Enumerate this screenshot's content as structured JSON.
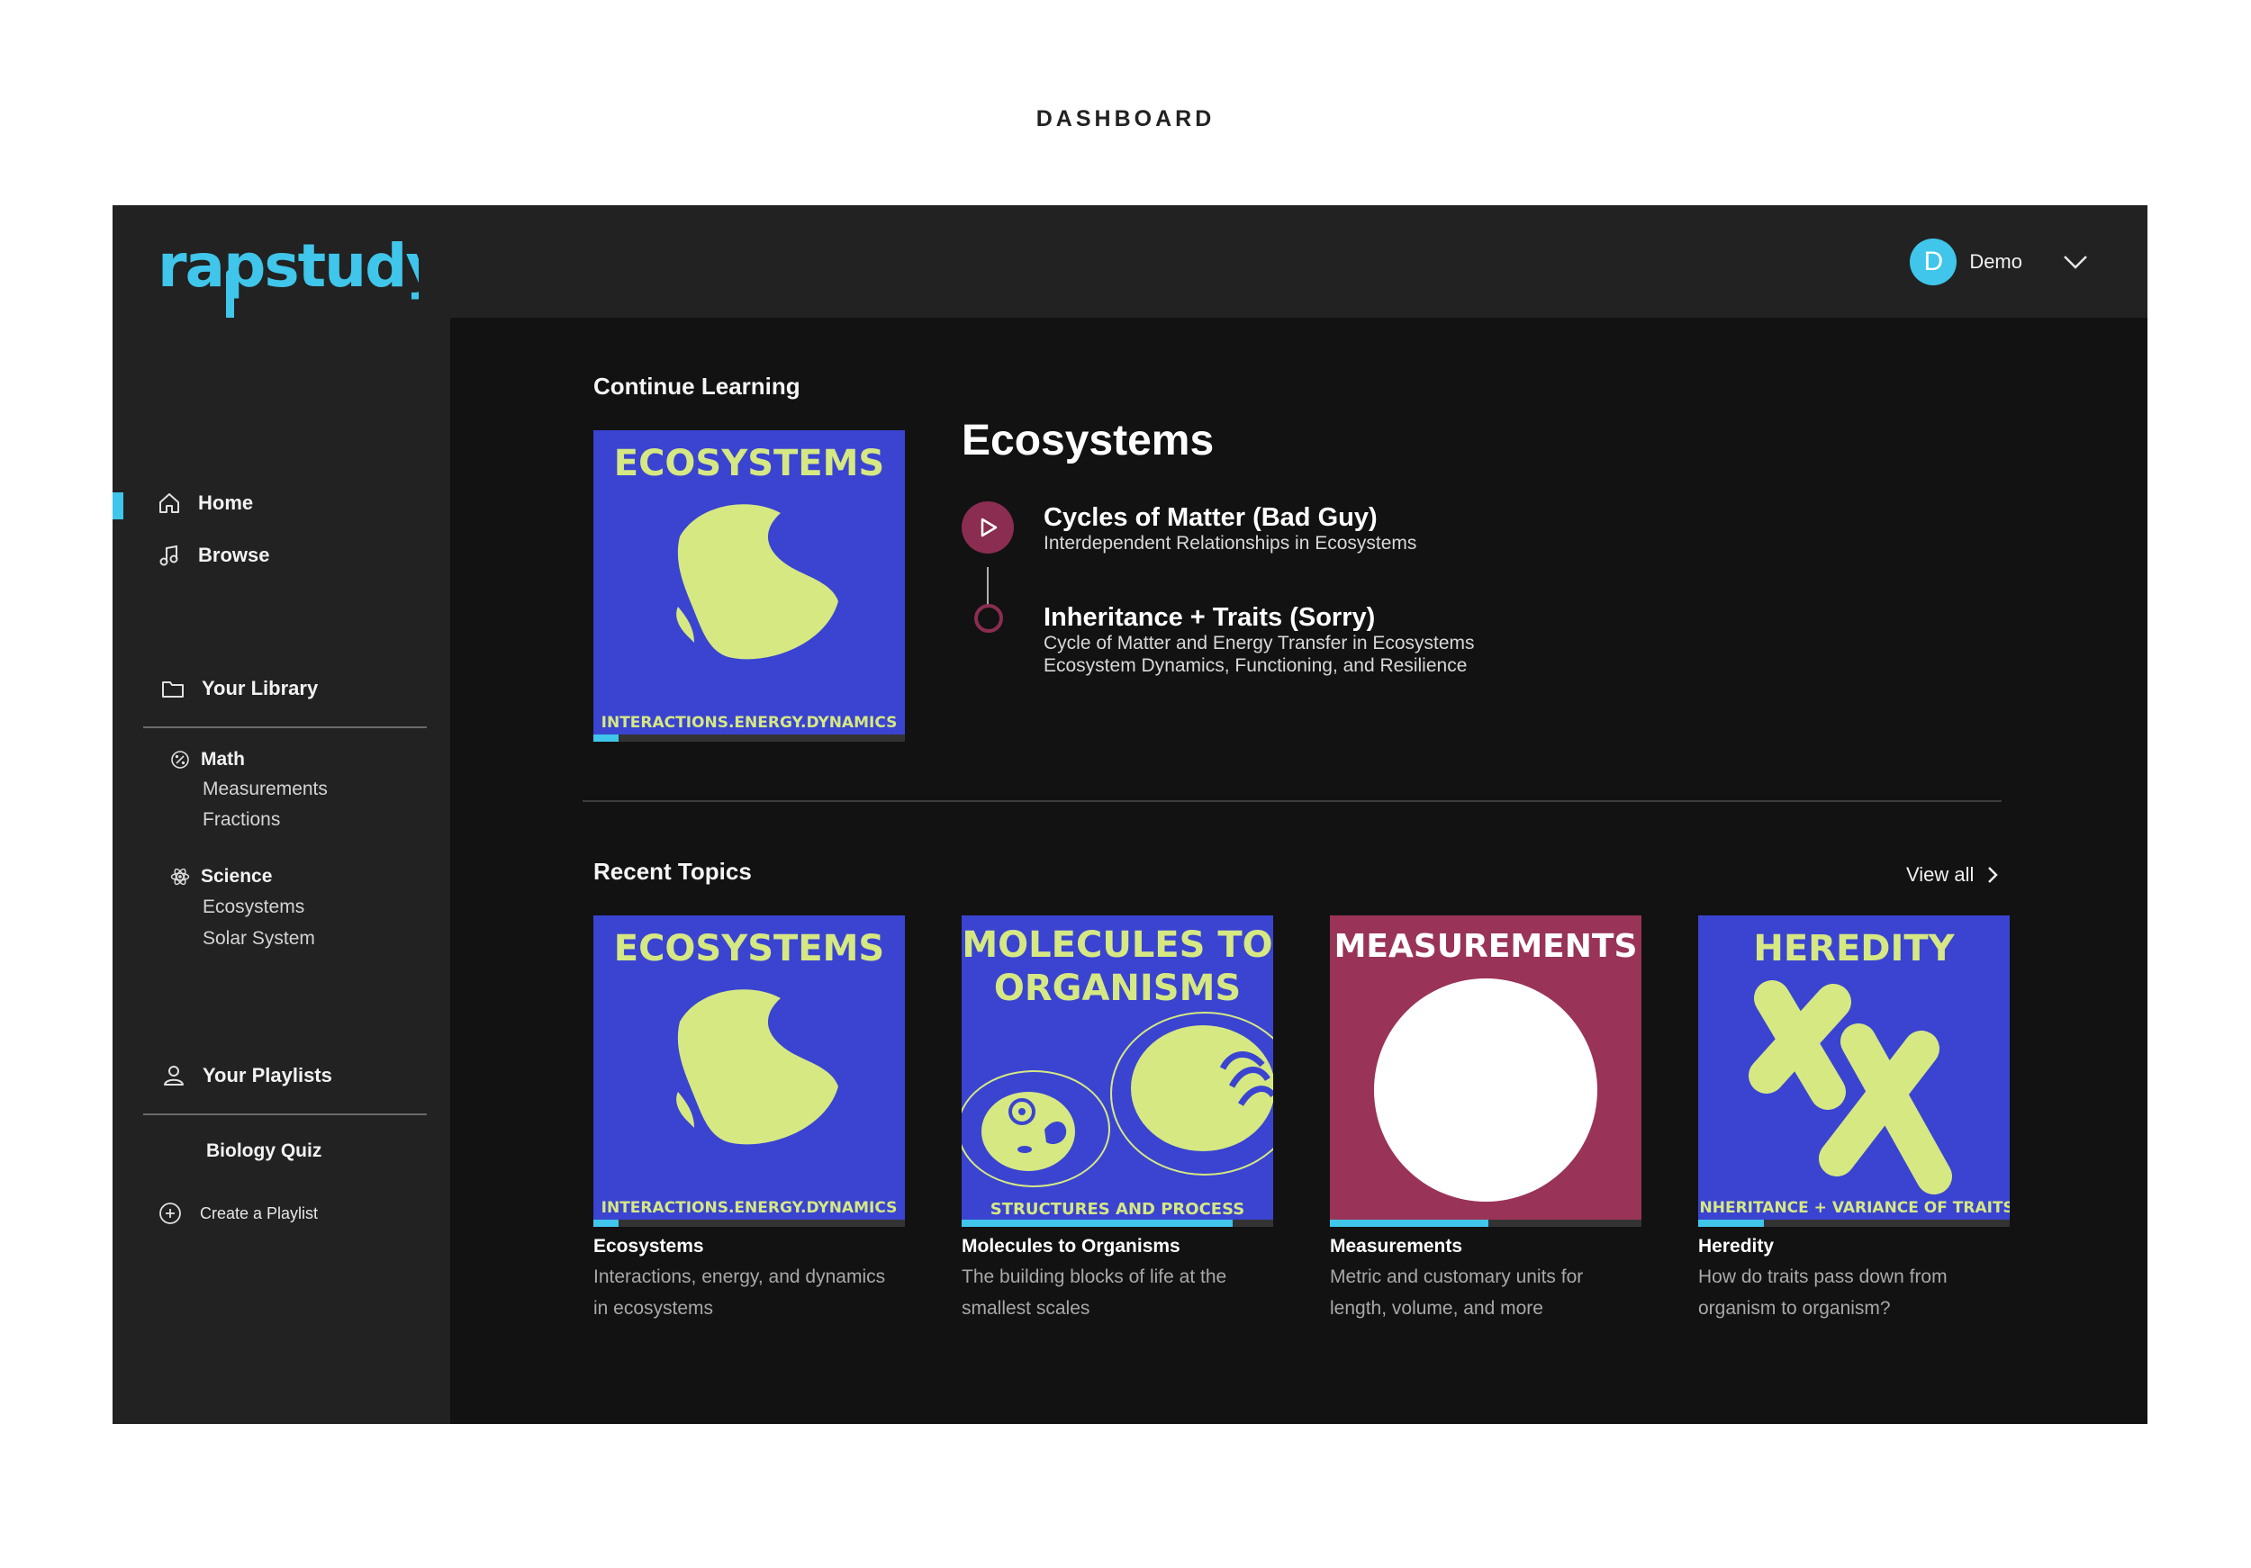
{
  "page_caption": "DASHBOARD",
  "brand": {
    "logo_text": "rapstudy",
    "accent": "#3fc6ea"
  },
  "user": {
    "initial": "D",
    "name": "Demo"
  },
  "nav": {
    "home": "Home",
    "browse": "Browse",
    "library": "Your Library",
    "playlists": "Your Playlists",
    "create_playlist": "Create a Playlist"
  },
  "library": {
    "categories": [
      {
        "name": "Math",
        "icon": "percent-icon",
        "items": [
          "Measurements",
          "Fractions"
        ]
      },
      {
        "name": "Science",
        "icon": "atom-icon",
        "items": [
          "Ecosystems",
          "Solar System"
        ]
      }
    ]
  },
  "playlists": [
    "Biology Quiz"
  ],
  "continue_learning": {
    "section_title": "Continue Learning",
    "topic_title": "Ecosystems",
    "progress": 0.08,
    "cover": {
      "headline": "ECOSYSTEMS",
      "footer": "INTERACTIONS.ENERGY.DYNAMICS"
    },
    "tracks": [
      {
        "title": "Cycles of Matter (Bad Guy)",
        "subtitles": [
          "Interdependent Relationships in Ecosystems"
        ],
        "state": "playing"
      },
      {
        "title": "Inheritance + Traits (Sorry)",
        "subtitles": [
          "Cycle of Matter and Energy Transfer in Ecosystems",
          "Ecosystem Dynamics, Functioning, and Resilience"
        ],
        "state": "next"
      }
    ]
  },
  "recent_topics": {
    "section_title": "Recent Topics",
    "view_all": "View all",
    "items": [
      {
        "title": "Ecosystems",
        "description": "Interactions, energy, and dynamics in ecosystems",
        "cover_headline": "ECOSYSTEMS",
        "cover_footer": "INTERACTIONS.ENERGY.DYNAMICS",
        "progress": 0.08
      },
      {
        "title": "Molecules to Organisms",
        "description": "The building blocks of life at the smallest scales",
        "cover_headline": [
          "MOLECULES TO",
          "ORGANISMS"
        ],
        "cover_footer": "STRUCTURES AND PROCESS",
        "progress": 0.87
      },
      {
        "title": "Measurements",
        "description": "Metric and customary units for length, volume, and more",
        "cover_headline": "MEASUREMENTS",
        "cover_footer": "",
        "progress": 0.51
      },
      {
        "title": "Heredity",
        "description": "How do traits pass down from organism to organism?",
        "cover_headline": "HEREDITY",
        "cover_footer": "INHERITANCE + VARIANCE OF TRAITS",
        "progress": 0.21
      }
    ]
  },
  "colors": {
    "cover_blue": "#3a44d1",
    "cover_lime": "#d6e882",
    "cover_maroon": "#9a3358",
    "play_button": "#8a2d50",
    "progress": "#3fc6ea"
  }
}
